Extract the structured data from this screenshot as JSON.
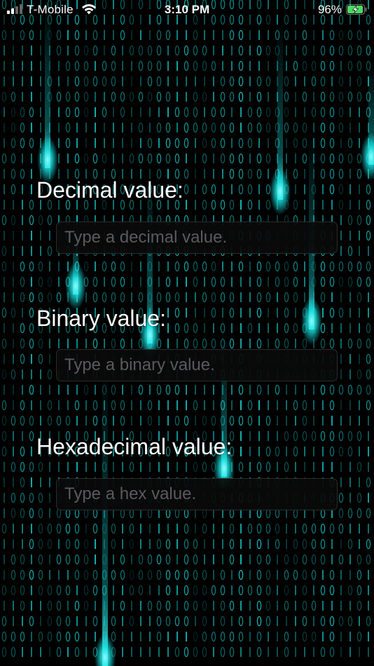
{
  "status_bar": {
    "carrier": "T-Mobile",
    "time": "3:10 PM",
    "battery_percent": "96%",
    "battery_level": 0.96,
    "signal_bars": 2,
    "signal_bars_total": 4,
    "charging": true,
    "battery_color": "#4cd964"
  },
  "form": {
    "decimal": {
      "label": "Decimal value:",
      "placeholder": "Type a decimal value.",
      "value": ""
    },
    "binary": {
      "label": "Binary value:",
      "placeholder": "Type a binary value.",
      "value": ""
    },
    "hex": {
      "label": "Hexadecimal value:",
      "placeholder": "Type a hex value.",
      "value": ""
    }
  },
  "theme": {
    "background": "#000000",
    "accent": "#19e6e6",
    "label_color": "#ffffff",
    "input_background": "#0a0a0a",
    "placeholder_color": "#5a5a5e"
  }
}
